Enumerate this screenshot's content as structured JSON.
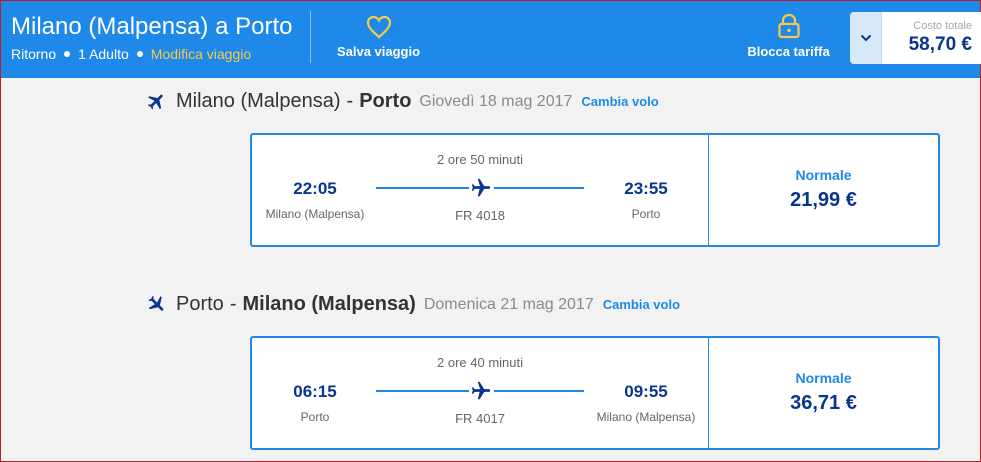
{
  "header": {
    "title": "Milano (Malpensa) a Porto",
    "trip_type": "Ritorno",
    "passengers": "1 Adulto",
    "modify_label": "Modifica viaggio",
    "save_label": "Salva viaggio",
    "lock_label": "Blocca tariffa",
    "cost_label": "Costo totale",
    "cost_value": "58,70 €"
  },
  "flights": [
    {
      "from": "Milano (Malpensa)",
      "to": "Porto",
      "date": "Giovedì 18 mag 2017",
      "change_label": "Cambia volo",
      "duration": "2 ore 50 minuti",
      "dep_time": "22:05",
      "dep_place": "Milano (Malpensa)",
      "arr_time": "23:55",
      "arr_place": "Porto",
      "flight_no": "FR 4018",
      "fare_type": "Normale",
      "price": "21,99 €"
    },
    {
      "from": "Porto",
      "to": "Milano (Malpensa)",
      "date": "Domenica 21 mag 2017",
      "change_label": "Cambia volo",
      "duration": "2 ore 40 minuti",
      "dep_time": "06:15",
      "dep_place": "Porto",
      "arr_time": "09:55",
      "arr_place": "Milano (Malpensa)",
      "flight_no": "FR 4017",
      "fare_type": "Normale",
      "price": "36,71 €"
    }
  ],
  "colors": {
    "header_bg": "#1e89e8",
    "accent_yellow": "#f7c94b",
    "navy": "#073590",
    "card_border": "#1e89e8"
  },
  "icons": {
    "save": "heart-icon",
    "lock": "lock-icon",
    "toggle": "chevron-down-icon",
    "plane": "plane-icon"
  }
}
